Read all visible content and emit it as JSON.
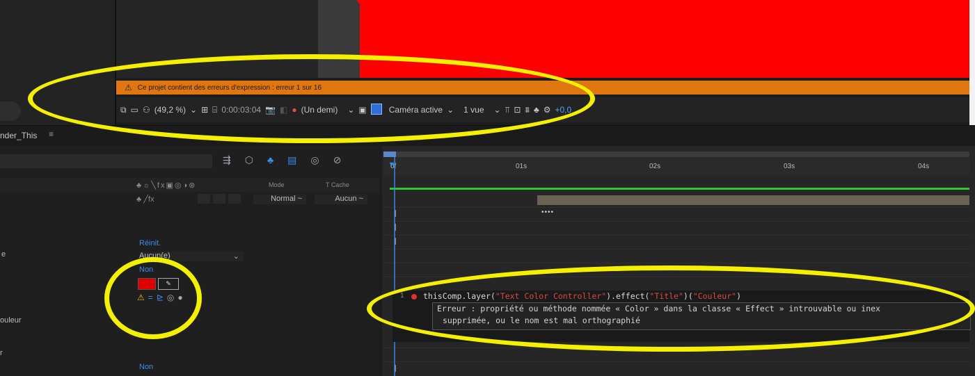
{
  "warning_bar": {
    "text": "Ce projet contient des erreurs d'expression : erreur 1 sur 16"
  },
  "viewer_toolbar": {
    "zoom": "(49,2 %)",
    "timecode": "0:00:03:04",
    "resolution": "(Un demi)",
    "camera": "Caméra active",
    "views": "1 vue",
    "exposure": "+0,0"
  },
  "timeline": {
    "tab_name": "nder_This",
    "tab_menu": "≡",
    "columns": {
      "mode": "Mode",
      "trkmat": "T  Cache"
    },
    "layer": {
      "mode": "Normal ~",
      "trkmat": "Aucun ~"
    },
    "ruler_ticks": [
      "0f",
      "01s",
      "02s",
      "03s",
      "04s"
    ],
    "keyframes": "••••"
  },
  "properties": {
    "reset_label": "Réinit.",
    "menu_value": "Aucun(e)",
    "non_label_1": "Non",
    "non_label_2": "Non",
    "left_label_e": "e",
    "left_label_couleur": "ouleur",
    "left_label_r": "r",
    "swatch_color": "#e10000"
  },
  "expression": {
    "line_number": "1",
    "code_prefix": "thisComp.layer(",
    "code_str1": "\"Text Color Controller\"",
    "code_mid1": ").effect(",
    "code_str2": "\"Title\"",
    "code_mid2": ")(",
    "code_str3": "\"Couleur\"",
    "code_end": ")",
    "error_line1": "Erreur : propriété ou méthode nommée « Color » dans la classe « Effect » introuvable ou inex",
    "error_line2": "supprimée, ou le nom est mal orthographié"
  },
  "colors": {
    "accent": "#3c8cf0",
    "warning": "#e0760f",
    "annotation": "#f5f000",
    "viewer_red": "#ff0000"
  }
}
